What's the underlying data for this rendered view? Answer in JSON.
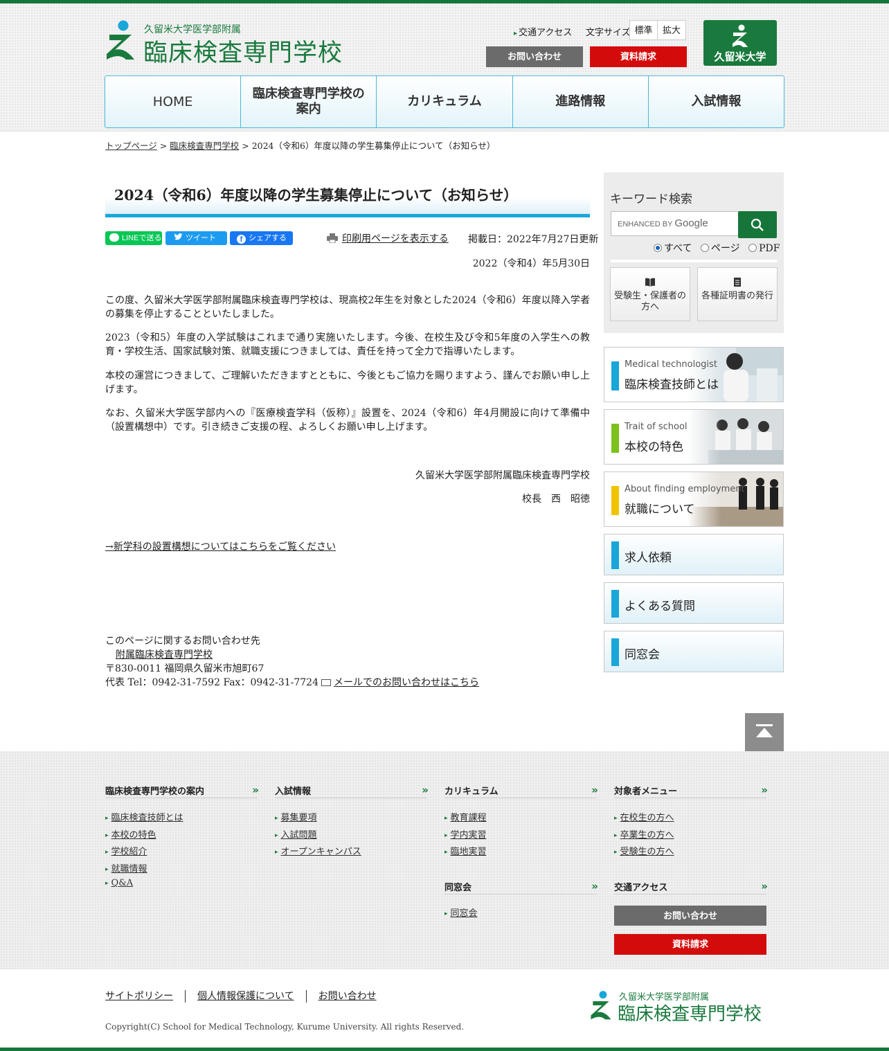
{
  "header": {
    "logo_sub": "久留米大学医学部附属",
    "logo_main": "臨床検査専門学校",
    "access_label": "交通アクセス",
    "font_size_label": "文字サイズ",
    "font_normal": "標準",
    "font_large": "拡大",
    "contact_button": "お問い合わせ",
    "request_button": "資料請求",
    "university_logo_text": "久留米大学"
  },
  "nav": {
    "items": [
      {
        "label": "HOME"
      },
      {
        "label": "臨床検査専門学校の案内"
      },
      {
        "label": "カリキュラム"
      },
      {
        "label": "進路情報"
      },
      {
        "label": "入試情報"
      }
    ]
  },
  "breadcrumb": {
    "home": "トップページ",
    "parent": "臨床検査専門学校",
    "separator": ">",
    "current": "2024（令和6）年度以降の学生募集停止について（お知らせ）"
  },
  "article": {
    "title": "2024（令和6）年度以降の学生募集停止について（お知らせ）",
    "share_line": "LINEで送る",
    "share_twitter": "ツイート",
    "share_facebook": "シェアする",
    "print_link": "印刷用ページを表示する",
    "published": "掲載日：2022年7月27日更新",
    "date": "2022（令和4）年5月30日",
    "paragraphs": [
      "この度、久留米大学医学部附属臨床検査専門学校は、現高校2年生を対象とした2024（令和6）年度以降入学者の募集を停止することといたしました。",
      "2023（令和5）年度の入学試験はこれまで通り実施いたします。今後、在校生及び令和5年度の入学生への教育・学校生活、国家試験対策、就職支援につきましては、責任を持って全力で指導いたします。",
      "本校の運営につきまして、ご理解いただきますとともに、今後ともご協力を賜りますよう、謹んでお願い申し上げます。",
      "なお、久留米大学医学部内への『医療検査学科（仮称）』設置を、2024（令和6）年4月開設に向けて準備中（設置構想中）です。引き続きご支援の程、よろしくお願い申し上げます。"
    ],
    "signature_org": "久留米大学医学部附属臨床検査専門学校",
    "signature_name": "校長　西　昭徳",
    "new_dept_link": "→新学科の設置構想についてはこちらをご覧ください"
  },
  "contact": {
    "heading": "このページに関するお問い合わせ先",
    "org_link": "附属臨床検査専門学校",
    "address": "〒830-0011 福岡県久留米市旭町67",
    "phone": "代表 Tel：0942-31-7592 Fax：0942-31-7724",
    "mail_link": "メールでのお問い合わせはこちら"
  },
  "sidebar": {
    "search_title": "キーワード検索",
    "search_placeholder_small": "ENHANCED BY",
    "search_placeholder_brand": "Google",
    "scope_all": "すべて",
    "scope_page": "ページ",
    "scope_pdf": "PDF",
    "quick1": "受験生・保護者の方へ",
    "quick2": "各種証明書の発行",
    "banners": [
      {
        "en": "Medical technologist",
        "ja": "臨床検査技師とは",
        "bar": "#19a6d8"
      },
      {
        "en": "Trait of school",
        "ja": "本校の特色",
        "bar": "#7cc21c"
      },
      {
        "en": "About finding employment",
        "ja": "就職について",
        "bar": "#f2c400"
      }
    ],
    "small_banners": [
      {
        "ja": "求人依頼"
      },
      {
        "ja": "よくある質問"
      },
      {
        "ja": "同窓会"
      }
    ]
  },
  "footer": {
    "col1": {
      "heading": "臨床検査専門学校の案内",
      "items": [
        "臨床検査技師とは",
        "本校の特色",
        "学校紹介",
        "就職情報",
        "Q&A"
      ]
    },
    "col2": {
      "heading": "入試情報",
      "items": [
        "募集要項",
        "入試問題",
        "オープンキャンパス"
      ]
    },
    "col3": {
      "heading": "カリキュラム",
      "items": [
        "教育課程",
        "学内実習",
        "臨地実習"
      ]
    },
    "col3b": {
      "heading": "同窓会",
      "items": [
        "同窓会"
      ]
    },
    "col4": {
      "heading": "対象者メニュー",
      "items": [
        "在校生の方へ",
        "卒業生の方へ",
        "受験生の方へ"
      ]
    },
    "col4b": {
      "heading": "交通アクセス"
    },
    "contact_button": "お問い合わせ",
    "request_button": "資料請求",
    "links": [
      "サイトポリシー",
      "個人情報保護について",
      "お問い合わせ"
    ],
    "copyright": "Copyright(C) School for Medical Technology, Kurume University. All rights Reserved.",
    "logo_sub": "久留米大学医学部附属",
    "logo_main": "臨床検査専門学校"
  },
  "colors": {
    "brand_green": "#1a7a3e",
    "accent_blue": "#19a6d8",
    "request_red": "#d40b0b"
  }
}
